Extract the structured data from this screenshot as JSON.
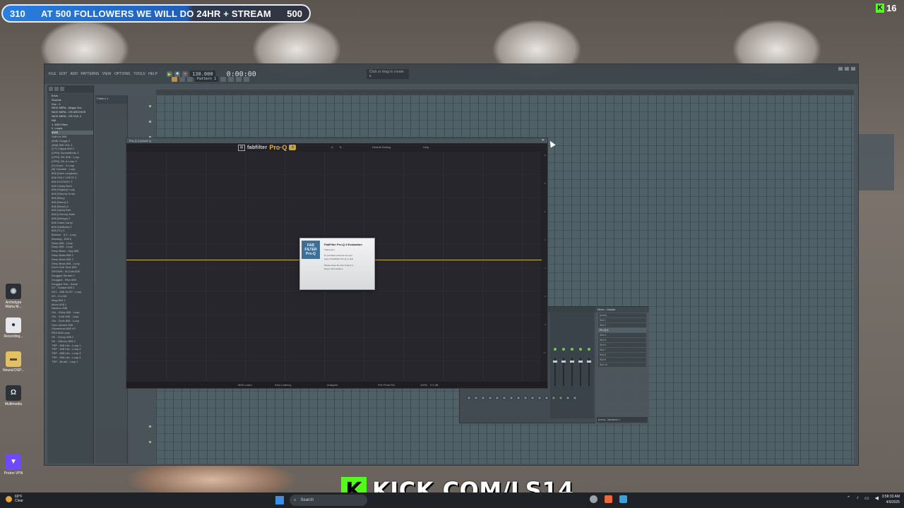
{
  "stream_banner": {
    "left_count": "310",
    "message": "AT 500 FOLLOWERS WE WILL DO 24HR + STREAM",
    "goal": "500",
    "viewer_count": "16",
    "kick_url": "KICK.COM/LS14"
  },
  "desktop_icons": [
    {
      "label": "Archetype Misha M...",
      "icon": "archetype-icon"
    },
    {
      "label": "Recording...",
      "icon": "recording-icon"
    },
    {
      "label": "Neural DSP...",
      "icon": "folder-icon"
    },
    {
      "label": "Multimedia",
      "icon": "headphones-icon"
    },
    {
      "label": "Proton VPN",
      "icon": "vpn-icon"
    }
  ],
  "fl_studio": {
    "time": "0:00:00",
    "tempo": "130.000",
    "pattern": "Pattern 1",
    "hint": "Click or drag to create a",
    "browser_items": [
      {
        "label": "Envs",
        "type": "folder"
      },
      {
        "label": "Sounds",
        "type": "folder"
      },
      {
        "label": "Voc - 1",
        "type": "folder"
      },
      {
        "label": "NICK MIRA - Magic Vox",
        "type": "folder"
      },
      {
        "label": "NICK MIRA - CR ARCHIVE",
        "type": "folder"
      },
      {
        "label": "NICK MIRA - CR VOL 1",
        "type": "folder"
      },
      {
        "label": "NM",
        "type": "folder"
      },
      {
        "label": "1. MIDI Files",
        "type": "folder"
      },
      {
        "label": "2. Loops",
        "type": "folder"
      },
      {
        "label": "808S",
        "type": "selected"
      },
      {
        "label": "Soft Ice 808",
        "type": "item"
      },
      {
        "label": "(808) Cloggs 2",
        "type": "item"
      },
      {
        "label": "(808) 808 VOL 2",
        "type": "item"
      },
      {
        "label": "(CT) Cappa 808 2",
        "type": "item"
      },
      {
        "label": "(OPN) SummMento 2",
        "type": "item"
      },
      {
        "label": "(OPN) Off- 808 - Loop",
        "type": "item"
      },
      {
        "label": "(OPN) Off- A Loop 2",
        "type": "item"
      },
      {
        "label": "(H) Drum - 3 Loop",
        "type": "item"
      },
      {
        "label": "(B) Clamble - Loop",
        "type": "item"
      },
      {
        "label": "808 (Dark Lengthen)",
        "type": "item"
      },
      {
        "label": "808 HOLY VOICE 2",
        "type": "item"
      },
      {
        "label": "808 ECSTASY 2",
        "type": "item"
      },
      {
        "label": "808 Clerky Bord",
        "type": "item"
      },
      {
        "label": "808 (Sugary) Loop",
        "type": "item"
      },
      {
        "label": "808 (Sherm) Drum",
        "type": "item"
      },
      {
        "label": "808 (Bery)",
        "type": "item"
      },
      {
        "label": "808 (Reen) 3",
        "type": "item"
      },
      {
        "label": "808 (Beset) 4",
        "type": "item"
      },
      {
        "label": "808 (Jaris) Sart",
        "type": "item"
      },
      {
        "label": "808 (Chemo) Mute",
        "type": "item"
      },
      {
        "label": "808 (Brimgo) 2",
        "type": "item"
      },
      {
        "label": "808 Claim Carryl",
        "type": "item"
      },
      {
        "label": "808 (Sailboat) 2",
        "type": "item"
      },
      {
        "label": "808 (TL) 2",
        "type": "item"
      },
      {
        "label": "Bowser - 8.2 - Loop",
        "type": "item"
      },
      {
        "label": "Bruising - 808 6",
        "type": "item"
      },
      {
        "label": "Deep 808 - Loop",
        "type": "item"
      },
      {
        "label": "Deep 808 - Loop",
        "type": "item"
      },
      {
        "label": "Deep Bass - Hug 808",
        "type": "item"
      },
      {
        "label": "Deep Bass 808 2",
        "type": "item"
      },
      {
        "label": "Deep Bass 808 2",
        "type": "item"
      },
      {
        "label": "Deep Bass 808 - Loop",
        "type": "item"
      },
      {
        "label": "Drum Sub Tone 808",
        "type": "item"
      },
      {
        "label": "DROWN - M-Cuts 808",
        "type": "item"
      },
      {
        "label": "Drugged Sender 2",
        "type": "item"
      },
      {
        "label": "Drugged - Rico 808",
        "type": "item"
      },
      {
        "label": "Drugged Sub - Alone",
        "type": "item"
      },
      {
        "label": "GT - Solace 808 2",
        "type": "item"
      },
      {
        "label": "KEY - 808 SLOP - Loop",
        "type": "item"
      },
      {
        "label": "KO - 8 LOW",
        "type": "item"
      },
      {
        "label": "Magi 808 1",
        "type": "item"
      },
      {
        "label": "Mono 808 1",
        "type": "item"
      },
      {
        "label": "Navarro 808",
        "type": "item"
      },
      {
        "label": "Oni - Glory 808 - Loop",
        "type": "item"
      },
      {
        "label": "Oni - Gold 808 - Loop",
        "type": "item"
      },
      {
        "label": "Oni - Sock 808 - Loop",
        "type": "item"
      },
      {
        "label": "Ouro Quatro 808",
        "type": "item"
      },
      {
        "label": "Occasional 808 VC",
        "type": "item"
      },
      {
        "label": "REA 808 Loop",
        "type": "item"
      },
      {
        "label": "SK - Ocoxy 808 2",
        "type": "item"
      },
      {
        "label": "SK - Odivory 808 2",
        "type": "item"
      },
      {
        "label": "TRP - 808 Lite - Loop 1",
        "type": "item"
      },
      {
        "label": "TRP - 808 Lite - Loop 2",
        "type": "item"
      },
      {
        "label": "TRP - 808 Lite - Loop 3",
        "type": "item"
      },
      {
        "label": "TRP - 808 Lite - Loop 4",
        "type": "item"
      },
      {
        "label": "TRP - Brutal - Loop 1",
        "type": "item"
      }
    ]
  },
  "proq": {
    "window_title": "Pro-Q 4 (Insert 1)",
    "brand": "fabfilter",
    "product": "Pro·Q",
    "version_badge": "4",
    "header_items": [
      "A",
      "B",
      "Default Setting",
      "Help"
    ],
    "footer_items": [
      "MIDI Learn",
      "Zero Latency",
      "Analyzer",
      "Pre+Post+SC",
      "100%",
      "0.0 dB"
    ],
    "db_scale": [
      "+9",
      "+6",
      "+3",
      "0",
      "-3",
      "-6",
      "-9",
      "-12"
    ],
    "dialog": {
      "icon_text": "FAB FILTER Pro-Q",
      "title": "FabFilter Pro-Q 4 Evaluation",
      "lines": [
        "Thank you!",
        "To purchase a license for your",
        "copy of FabFilter Pro-Q 4, click",
        "Please close the host (main) or",
        "plug-in and reload it."
      ]
    }
  },
  "mixer": {
    "title": "Mixer - Master",
    "insert_title": "Mixer - Master",
    "inserts": [
      "(none)",
      "Slot 1",
      "Slot 2",
      "Pro-Q 4",
      "Slot 4",
      "Slot 5",
      "Slot 6",
      "Slot 7",
      "Slot 8",
      "Slot 9",
      "Slot 10"
    ],
    "footer": "(none) - Speakers 1"
  },
  "taskbar": {
    "weather_temp": "69°F",
    "weather_desc": "Clear",
    "search_placeholder": "Search",
    "time": "3:58:33 AM",
    "date": "4/9/2025"
  },
  "colors": {
    "kick_green": "#53fc18",
    "banner_blue": "#2a7fe0",
    "eq_line": "#c8b25c"
  }
}
